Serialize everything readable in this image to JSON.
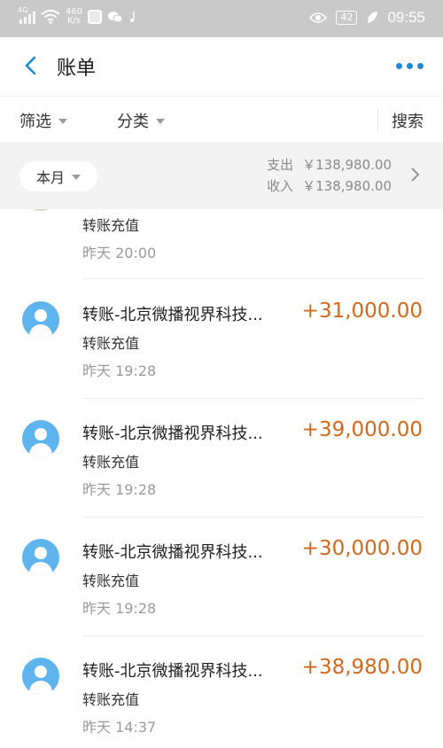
{
  "status_bar": {
    "network": "4G",
    "speed_value": "460",
    "speed_unit": "K/s",
    "battery": "42",
    "time": "09:55"
  },
  "header": {
    "title": "账单"
  },
  "filters": {
    "filter_label": "筛选",
    "category_label": "分类",
    "search_label": "搜索"
  },
  "summary": {
    "month_label": "本月",
    "expense_label": "支出",
    "expense_value": "￥138,980.00",
    "income_label": "收入",
    "income_value": "￥138,980.00"
  },
  "transactions": [
    {
      "name": "",
      "amount": "",
      "subtitle": "转账充值",
      "time": "昨天  20:00"
    },
    {
      "name": "转账-北京微播视界科技...",
      "amount": "+31,000.00",
      "subtitle": "转账充值",
      "time": "昨天  19:28"
    },
    {
      "name": "转账-北京微播视界科技...",
      "amount": "+39,000.00",
      "subtitle": "转账充值",
      "time": "昨天  19:28"
    },
    {
      "name": "转账-北京微播视界科技...",
      "amount": "+30,000.00",
      "subtitle": "转账充值",
      "time": "昨天  19:28"
    },
    {
      "name": "转账-北京微播视界科技...",
      "amount": "+38,980.00",
      "subtitle": "转账充值",
      "time": "昨天  14:37"
    }
  ],
  "colors": {
    "accent": "#1a8ad6",
    "amount": "#cf6a1c",
    "avatar": "#5fb4ee",
    "status_bar": "#c9c9c9"
  }
}
